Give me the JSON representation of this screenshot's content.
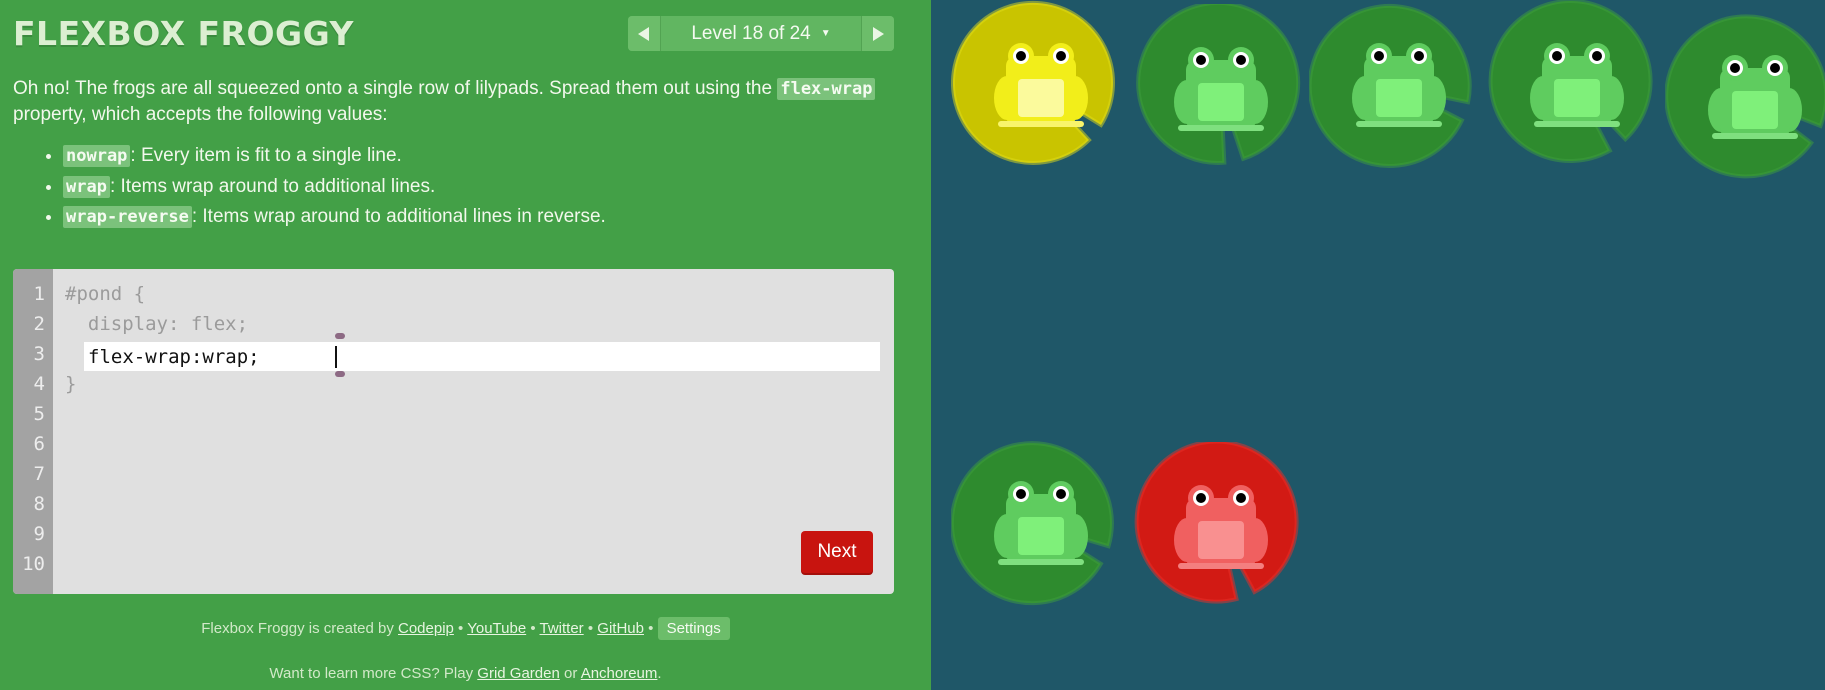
{
  "app": {
    "title": "FLEXBOX FROGGY"
  },
  "level_nav": {
    "label": "Level 18 of 24",
    "prev_icon": "triangle-left-icon",
    "next_icon": "triangle-right-icon"
  },
  "instructions": {
    "intro_before": "Oh no! The frogs are all squeezed onto a single row of lilypads. Spread them out using the ",
    "intro_keyword": "flex-wrap",
    "intro_after": " property, which accepts the following values:",
    "values": [
      {
        "keyword": "nowrap",
        "desc": ": Every item is fit to a single line."
      },
      {
        "keyword": "wrap",
        "desc": ": Items wrap around to additional lines."
      },
      {
        "keyword": "wrap-reverse",
        "desc": ": Items wrap around to additional lines in reverse."
      }
    ]
  },
  "editor": {
    "line_numbers": [
      "1",
      "2",
      "3",
      "4",
      "5",
      "6",
      "7",
      "8",
      "9",
      "10"
    ],
    "line1": "#pond {",
    "line2": "  display: flex;",
    "input_value": "flex-wrap:wrap;",
    "line4": "}",
    "next_label": "Next"
  },
  "credits": {
    "prefix": "Flexbox Froggy is created by ",
    "links": [
      "Codepip",
      "YouTube",
      "Twitter",
      "GitHub"
    ],
    "separator": " • ",
    "settings_label": "Settings"
  },
  "more_css": {
    "prefix": "Want to learn more CSS? Play ",
    "link1": "Grid Garden",
    "middle": " or ",
    "link2": "Anchoreum",
    "suffix": "."
  },
  "colors": {
    "sidebar_bg": "#43a047",
    "pond_bg": "#1f5768",
    "yellow_pad": "#c9c400",
    "green_pad": "#2e8b2e",
    "red_pad": "#d21a14"
  },
  "pond": {
    "lilypads": [
      {
        "color": "yellow"
      },
      {
        "color": "green"
      },
      {
        "color": "green"
      },
      {
        "color": "green"
      },
      {
        "color": "green"
      },
      {
        "color": "green"
      },
      {
        "color": "red"
      }
    ],
    "frogs": [
      {
        "color": "yellow"
      },
      {
        "color": "green"
      },
      {
        "color": "green"
      },
      {
        "color": "green"
      },
      {
        "color": "green"
      },
      {
        "color": "green"
      },
      {
        "color": "red"
      }
    ]
  }
}
